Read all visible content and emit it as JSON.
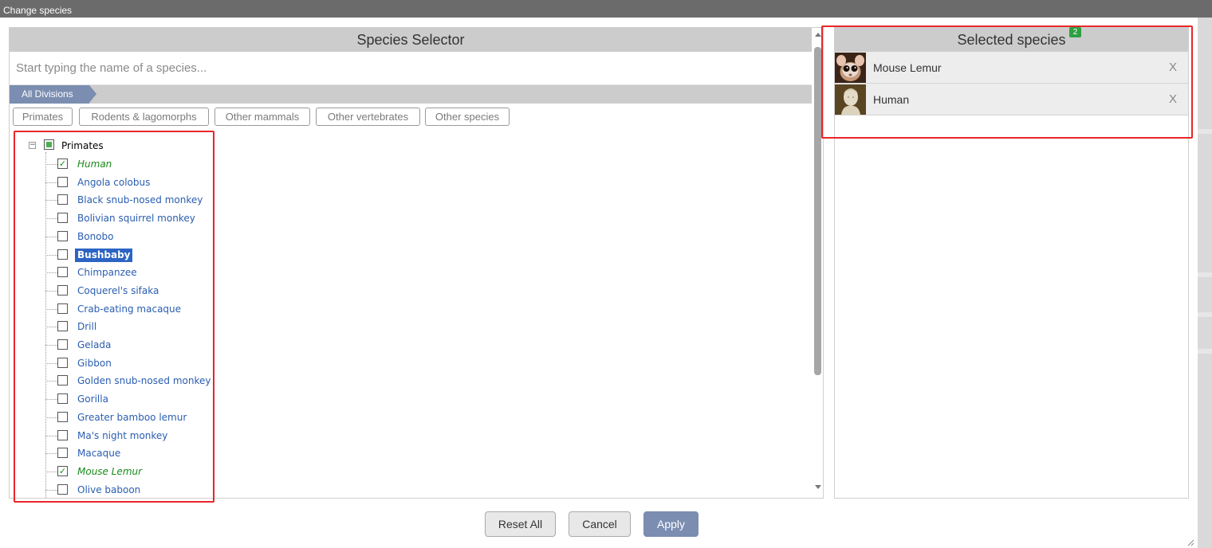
{
  "window": {
    "title": "Change species"
  },
  "selector": {
    "header": "Species Selector",
    "search_placeholder": "Start typing the name of a species...",
    "division_tab": "All Divisions",
    "filters": [
      "Primates",
      "Rodents & lagomorphs",
      "Other mammals",
      "Other vertebrates",
      "Other species"
    ],
    "tree": {
      "root_label": "Primates",
      "root_expander": "−",
      "items": [
        {
          "label": "Human",
          "checked": true
        },
        {
          "label": "Angola colobus",
          "checked": false
        },
        {
          "label": "Black snub-nosed monkey",
          "checked": false
        },
        {
          "label": "Bolivian squirrel monkey",
          "checked": false
        },
        {
          "label": "Bonobo",
          "checked": false
        },
        {
          "label": "Bushbaby",
          "checked": false,
          "highlighted": true
        },
        {
          "label": "Chimpanzee",
          "checked": false
        },
        {
          "label": "Coquerel's sifaka",
          "checked": false
        },
        {
          "label": "Crab-eating macaque",
          "checked": false
        },
        {
          "label": "Drill",
          "checked": false
        },
        {
          "label": "Gelada",
          "checked": false
        },
        {
          "label": "Gibbon",
          "checked": false
        },
        {
          "label": "Golden snub-nosed monkey",
          "checked": false
        },
        {
          "label": "Gorilla",
          "checked": false
        },
        {
          "label": "Greater bamboo lemur",
          "checked": false
        },
        {
          "label": "Ma's night monkey",
          "checked": false
        },
        {
          "label": "Macaque",
          "checked": false
        },
        {
          "label": "Mouse Lemur",
          "checked": true
        },
        {
          "label": "Olive baboon",
          "checked": false
        }
      ]
    }
  },
  "selected": {
    "header": "Selected species",
    "count": "2",
    "items": [
      {
        "name": "Mouse Lemur",
        "remove": "X",
        "icon": "mouse-lemur-thumbnail"
      },
      {
        "name": "Human",
        "remove": "X",
        "icon": "human-bust-thumbnail"
      }
    ]
  },
  "buttons": {
    "reset": "Reset All",
    "cancel": "Cancel",
    "apply": "Apply"
  },
  "colors": {
    "accent": "#7b8db0",
    "highlight_border": "#e8262a",
    "badge": "#2ea043",
    "checked_text": "#1a8a1a",
    "link_text": "#2a5db0"
  }
}
